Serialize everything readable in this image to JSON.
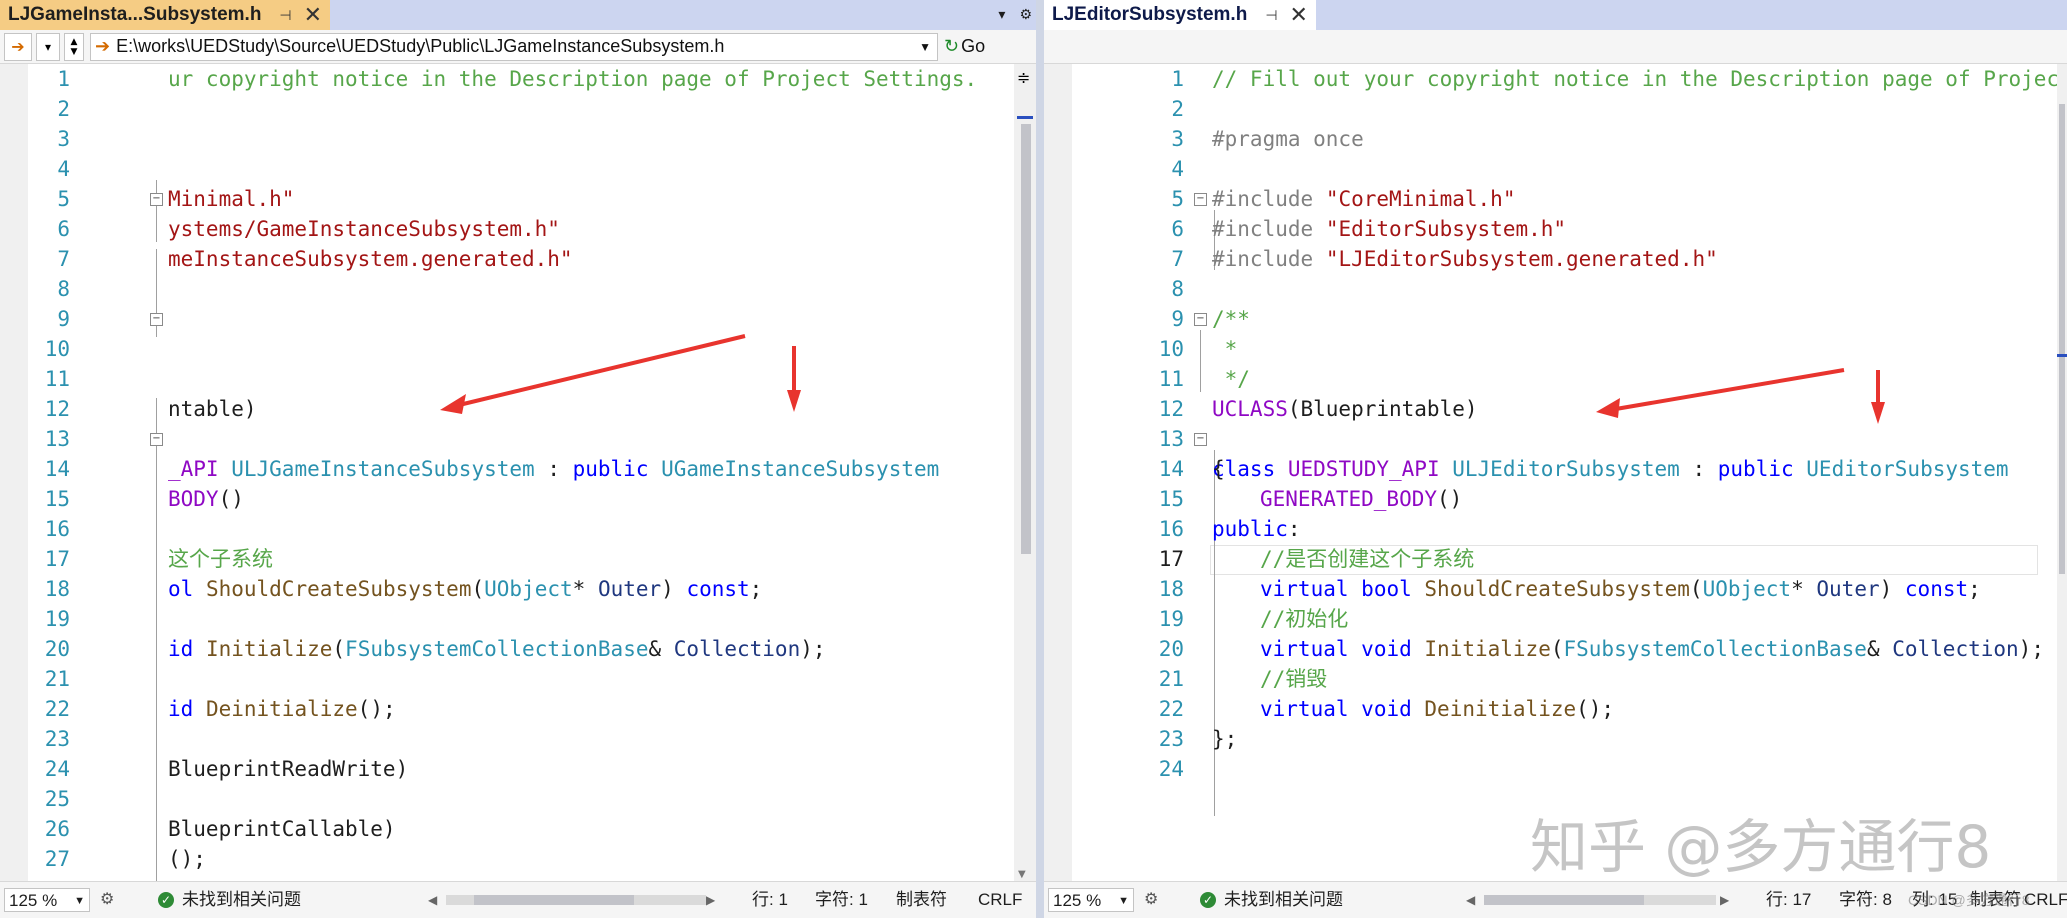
{
  "left": {
    "tab": {
      "title": "LJGameInsta...Subsystem.h",
      "pin": "⊣",
      "close": "✕"
    },
    "path": "E:\\works\\UEDStudy\\Source\\UEDStudy\\Public\\LJGameInstanceSubsystem.h",
    "go_label": "Go",
    "lines": [
      "1",
      "2",
      "3",
      "4",
      "5",
      "6",
      "7",
      "8",
      "9",
      "10",
      "11",
      "12",
      "13",
      "14",
      "15",
      "16",
      "17",
      "18",
      "19",
      "20",
      "21",
      "22",
      "23",
      "24",
      "25",
      "26",
      "27"
    ],
    "code": {
      "l1": "ur copyright notice in the Description page of Project Settings.",
      "l5": "Minimal.h\"",
      "l6": "ystems/GameInstanceSubsystem.h\"",
      "l7": "meInstanceSubsystem.generated.h\"",
      "l12": "ntable)",
      "l13a": "_API",
      "l13b": "ULJGameInstanceSubsystem",
      "l13c": " : ",
      "l13d": "public",
      "l13e": "UGameInstanceSubsystem",
      "l15a": "BODY",
      "l15b": "()",
      "l17": "这个子系统",
      "l18a": "ol",
      "l18b": "ShouldCreateSubsystem",
      "l18c": "(",
      "l18d": "UObject",
      "l18e": "* ",
      "l18f": "Outer",
      "l18g": ") ",
      "l18h": "const",
      "l18i": ";",
      "l20a": "id",
      "l20b": "Initialize",
      "l20c": "(",
      "l20d": "FSubsystemCollectionBase",
      "l20e": "& ",
      "l20f": "Collection",
      "l20g": ");",
      "l22a": "id",
      "l22b": "Deinitialize",
      "l22c": "();",
      "l24": "BlueprintReadWrite)",
      "l26": "BlueprintCallable)",
      "l27": "();"
    },
    "status": {
      "zoom": "125 %",
      "issues": "未找到相关问题",
      "line": "行: 1",
      "char": "字符: 1",
      "tabs": "制表符",
      "eol": "CRLF"
    }
  },
  "right": {
    "tab": {
      "title": "LJEditorSubsystem.h",
      "pin": "⊣",
      "close": "✕"
    },
    "lines": [
      "1",
      "2",
      "3",
      "4",
      "5",
      "6",
      "7",
      "8",
      "9",
      "10",
      "11",
      "12",
      "13",
      "14",
      "15",
      "16",
      "17",
      "18",
      "19",
      "20",
      "21",
      "22",
      "23",
      "24"
    ],
    "code": {
      "l1": "// Fill out your copyright notice in the Description page of Project",
      "l3": "#pragma once",
      "l5a": "#include",
      "l5b": "\"CoreMinimal.h\"",
      "l6a": "#include",
      "l6b": "\"EditorSubsystem.h\"",
      "l7a": "#include",
      "l7b": "\"LJEditorSubsystem.generated.h\"",
      "l9": "/**",
      "l10": " *",
      "l11": " */",
      "l12a": "UCLASS",
      "l12b": "(Blueprintable)",
      "l13a": "class",
      "l13b": "UEDSTUDY_API",
      "l13c": "ULJEditorSubsystem",
      "l13d": " : ",
      "l13e": "public",
      "l13f": "UEditorSubsystem",
      "l14": "{",
      "l15a": "GENERATED_BODY",
      "l15b": "()",
      "l16a": "public",
      "l16b": ":",
      "l17": "//是否创建这个子系统",
      "l18a": "virtual",
      "l18b": "bool",
      "l18c": "ShouldCreateSubsystem",
      "l18d": "(",
      "l18e": "UObject",
      "l18f": "* ",
      "l18g": "Outer",
      "l18h": ") ",
      "l18i": "const",
      "l18j": ";",
      "l19": "//初始化",
      "l20a": "virtual",
      "l20b": "void",
      "l20c": "Initialize",
      "l20d": "(",
      "l20e": "FSubsystemCollectionBase",
      "l20f": "& ",
      "l20g": "Collection",
      "l20h": ");",
      "l21": "//销毁",
      "l22a": "virtual",
      "l22b": "void",
      "l22c": "Deinitialize",
      "l22d": "();",
      "l23": "};"
    },
    "status": {
      "zoom": "125 %",
      "issues": "未找到相关问题",
      "line": "行: 17",
      "char": "字符: 8",
      "col": "列: 15",
      "tabs": "制表符",
      "eol": "CRLF"
    }
  },
  "watermark": "知乎 @多方通行8",
  "csdn": "CSDN @多方通行8",
  "colors": {
    "tab_active": "#f5cc84",
    "arrow": "#e8342e",
    "comment": "#57a64a",
    "keyword": "#0000ff",
    "type": "#2b91af",
    "string": "#a31515",
    "macro": "#8f08c4"
  }
}
